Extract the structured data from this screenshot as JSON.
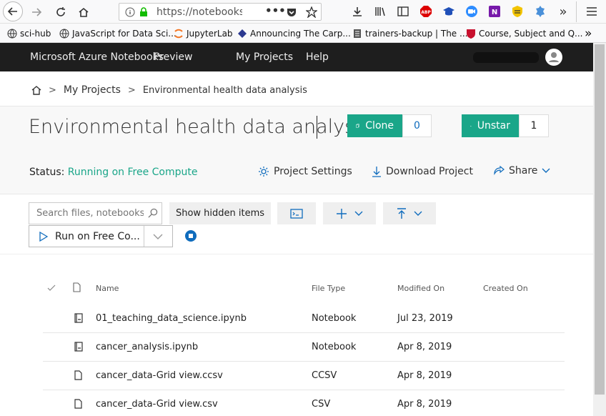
{
  "browser": {
    "url": "https://notebooks.a",
    "bookmarks": [
      {
        "label": "sci-hub"
      },
      {
        "label": "JavaScript for Data Sci..."
      },
      {
        "label": "JupyterLab"
      },
      {
        "label": "Announcing The Carp..."
      },
      {
        "label": "trainers-backup | The ..."
      },
      {
        "label": "Course, Subject and Q..."
      }
    ]
  },
  "header": {
    "brand": "Microsoft Azure Notebooks",
    "preview": "Preview",
    "my_projects": "My Projects",
    "help": "Help"
  },
  "breadcrumb": {
    "my_projects": "My Projects",
    "current": "Environmental health data analysis"
  },
  "project": {
    "title": "Environmental health data analysis",
    "clone_label": "Clone",
    "clone_count": "0",
    "star_label": "Unstar",
    "star_count": "1",
    "status_label": "Status:",
    "status_value": "Running on Free Compute",
    "settings_label": "Project Settings",
    "download_label": "Download Project",
    "share_label": "Share"
  },
  "toolbar": {
    "search_placeholder": "Search files, notebooks...",
    "show_hidden": "Show hidden items",
    "run_label": "Run on Free Co..."
  },
  "table": {
    "columns": {
      "name": "Name",
      "type": "File Type",
      "modified": "Modified On",
      "created": "Created On"
    },
    "rows": [
      {
        "name": "01_teaching_data_science.ipynb",
        "type": "Notebook",
        "modified": "Jul 23, 2019",
        "icon": "notebook-icon"
      },
      {
        "name": "cancer_analysis.ipynb",
        "type": "Notebook",
        "modified": "Apr 8, 2019",
        "icon": "notebook-icon"
      },
      {
        "name": "cancer_data-Grid view.ccsv",
        "type": "CCSV",
        "modified": "Apr 8, 2019",
        "icon": "file-icon"
      },
      {
        "name": "cancer_data-Grid view.csv",
        "type": "CSV",
        "modified": "Apr 8, 2019",
        "icon": "file-icon"
      }
    ]
  },
  "colors": {
    "accent": "#1aa689",
    "header_bg": "#1e1e1e",
    "stop_blue": "#0f6cbd"
  }
}
